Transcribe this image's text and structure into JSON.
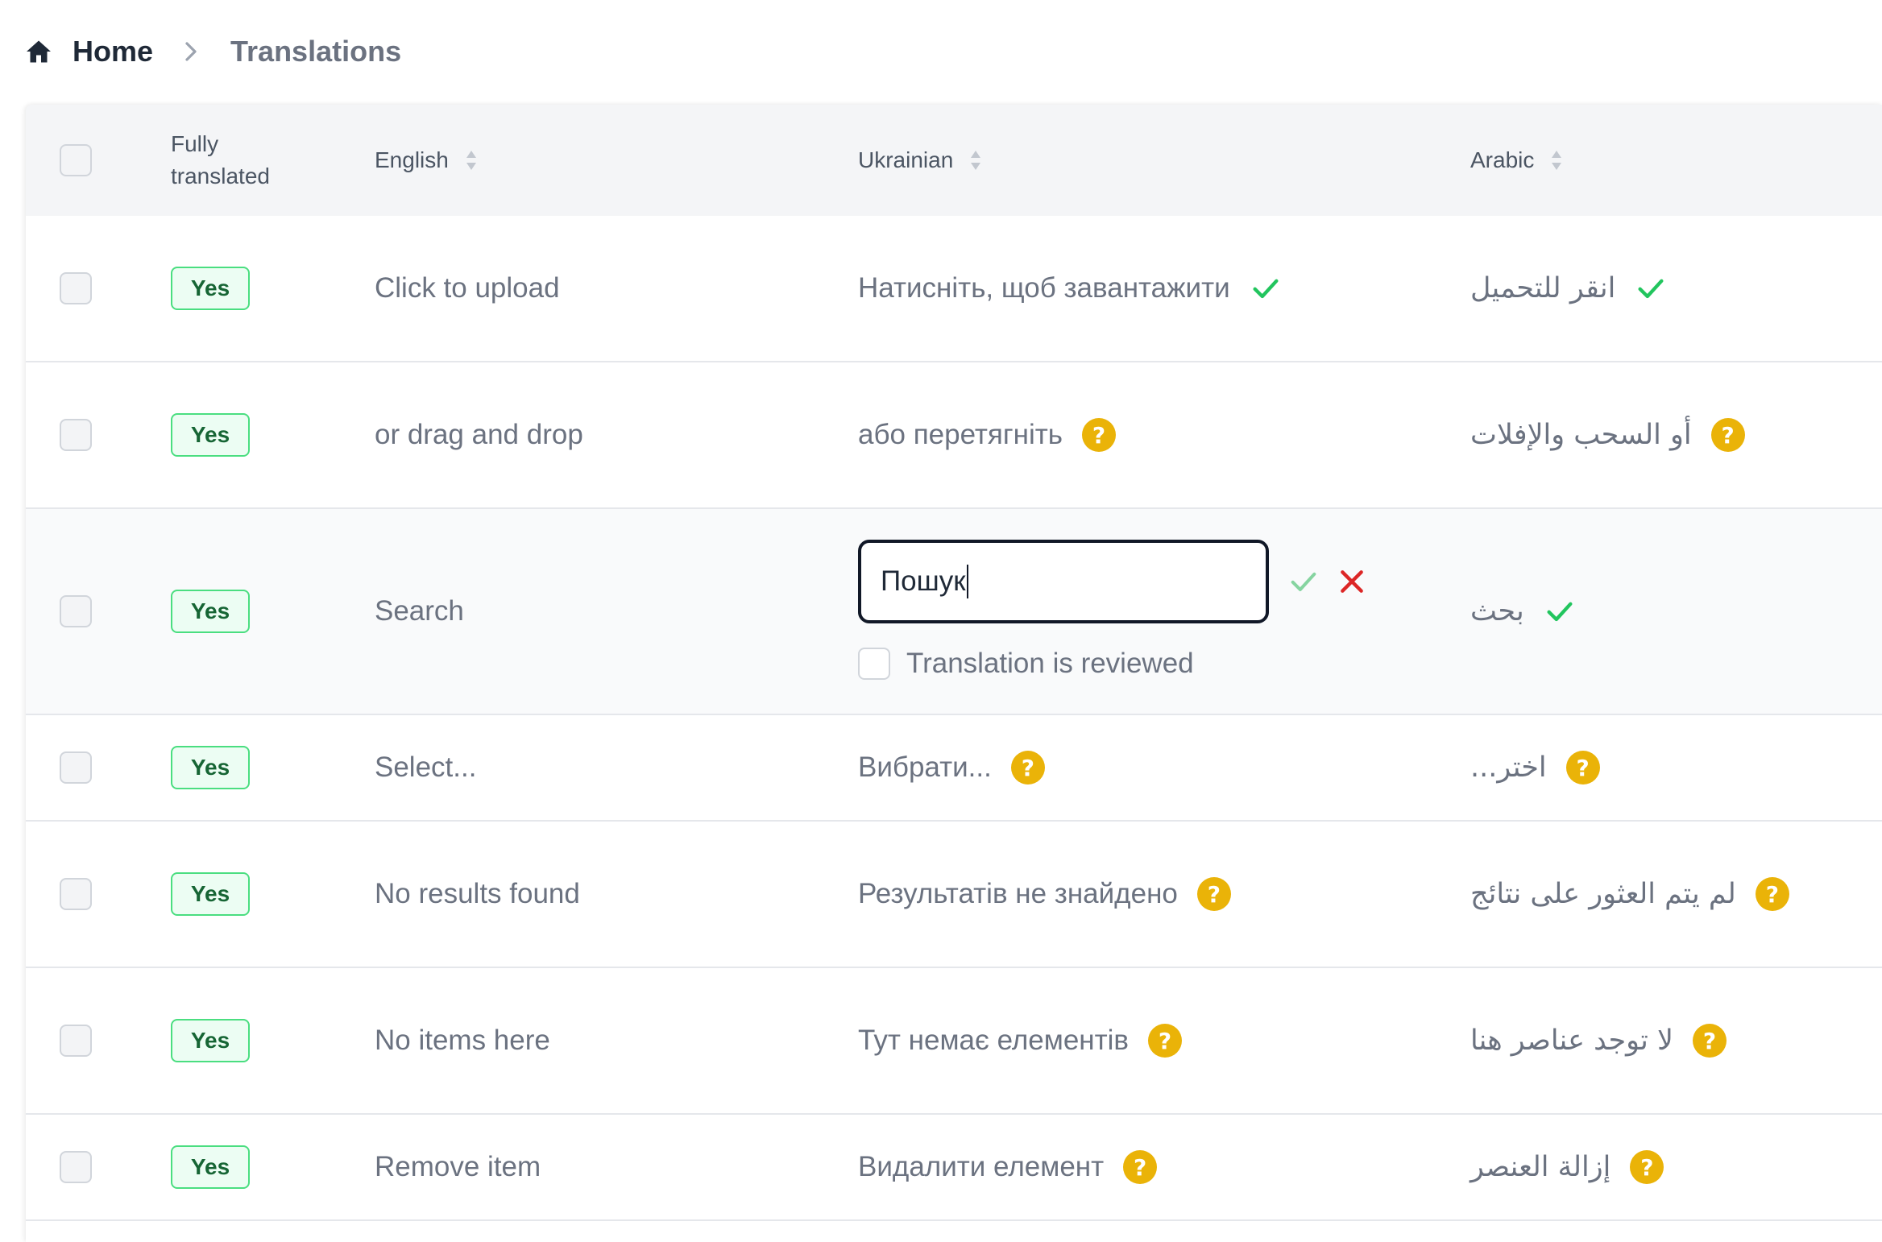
{
  "breadcrumb": {
    "home_label": "Home",
    "current_label": "Translations"
  },
  "table": {
    "columns": {
      "fully_translated_line1": "Fully",
      "fully_translated_line2": "translated",
      "english": "English",
      "ukrainian": "Ukrainian",
      "arabic": "Arabic"
    },
    "rows": [
      {
        "fully_translated": "Yes",
        "english": "Click to upload",
        "ukrainian": "Натисніть, щоб завантажити",
        "ukrainian_status": "reviewed",
        "arabic": "انقر للتحميل",
        "arabic_status": "reviewed"
      },
      {
        "fully_translated": "Yes",
        "english": "or drag and drop",
        "ukrainian": "або перетягніть",
        "ukrainian_status": "unreviewed",
        "arabic": "أو السحب والإفلات",
        "arabic_status": "unreviewed"
      },
      {
        "fully_translated": "Yes",
        "english": "Search",
        "ukrainian": "Пошук",
        "ukrainian_status": "editing",
        "arabic": "بحث",
        "arabic_status": "reviewed"
      },
      {
        "fully_translated": "Yes",
        "english": "Select...",
        "ukrainian": "Вибрати...",
        "ukrainian_status": "unreviewed",
        "arabic": "اختر...",
        "arabic_status": "unreviewed"
      },
      {
        "fully_translated": "Yes",
        "english": "No results found",
        "ukrainian": "Результатів не знайдено",
        "ukrainian_status": "unreviewed",
        "arabic": "لم يتم العثور على نتائج",
        "arabic_status": "unreviewed"
      },
      {
        "fully_translated": "Yes",
        "english": "No items here",
        "ukrainian": "Тут немає елементів",
        "ukrainian_status": "unreviewed",
        "arabic": "لا توجد عناصر هنا",
        "arabic_status": "unreviewed"
      },
      {
        "fully_translated": "Yes",
        "english": "Remove item",
        "ukrainian": "Видалити елемент",
        "ukrainian_status": "unreviewed",
        "arabic": "إزالة العنصر",
        "arabic_status": "unreviewed"
      }
    ],
    "edit": {
      "input_value": "Пошук",
      "reviewed_checkbox_label": "Translation is reviewed"
    },
    "question_glyph": "?"
  },
  "colors": {
    "reviewed_check": "#22c55e",
    "unreviewed_badge": "#eab308",
    "cancel": "#dc2626",
    "badge_border": "#4ade80"
  },
  "icons": {
    "home": "home-icon",
    "separator": "chevron-right-icon",
    "sort": "sort-icon",
    "reviewed": "check-icon",
    "unreviewed": "question-circle-icon",
    "save": "check-icon",
    "cancel": "close-icon"
  }
}
